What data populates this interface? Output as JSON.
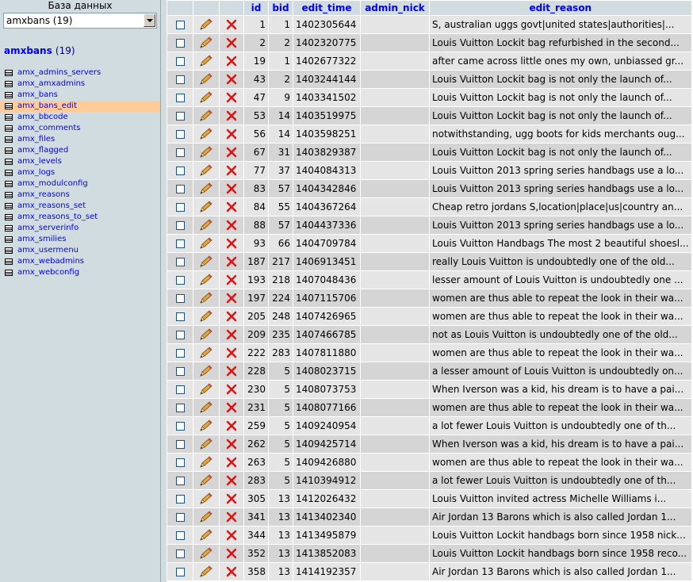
{
  "sidebar": {
    "db_label": "База данных",
    "db_select_value": "amxbans (19)",
    "db_name": "amxbans",
    "db_count": "(19)",
    "tables": [
      "amx_admins_servers",
      "amx_amxadmins",
      "amx_bans",
      "amx_bans_edit",
      "amx_bbcode",
      "amx_comments",
      "amx_files",
      "amx_flagged",
      "amx_levels",
      "amx_logs",
      "amx_modulconfig",
      "amx_reasons",
      "amx_reasons_set",
      "amx_reasons_to_set",
      "amx_serverinfo",
      "amx_smilies",
      "amx_usermenu",
      "amx_webadmins",
      "amx_webconfig"
    ],
    "active_table": "amx_bans_edit"
  },
  "table": {
    "columns": [
      "id",
      "bid",
      "edit_time",
      "admin_nick",
      "edit_reason"
    ],
    "rows": [
      [
        "1",
        "1",
        "1402305644",
        "",
        "S, australian uggs govt|united states|authorities|..."
      ],
      [
        "2",
        "2",
        "1402320775",
        "",
        "Louis Vuitton Lockit bag refurbished in the second..."
      ],
      [
        "19",
        "1",
        "1402677322",
        "",
        "after came across little ones my own, unbiassed gr..."
      ],
      [
        "43",
        "2",
        "1403244144",
        "",
        "Louis Vuitton Lockit bag is not only the launch of..."
      ],
      [
        "47",
        "9",
        "1403341502",
        "",
        "Louis Vuitton Lockit bag is not only the launch of..."
      ],
      [
        "53",
        "14",
        "1403519975",
        "",
        "Louis Vuitton Lockit bag is not only the launch of..."
      ],
      [
        "56",
        "14",
        "1403598251",
        "",
        "notwithstanding, ugg boots for kids  merchants oug..."
      ],
      [
        "67",
        "31",
        "1403829387",
        "",
        "Louis Vuitton Lockit bag is not only the launch of..."
      ],
      [
        "77",
        "37",
        "1404084313",
        "",
        "Louis Vuitton 2013 spring series handbags use a lo..."
      ],
      [
        "83",
        "57",
        "1404342846",
        "",
        "Louis Vuitton 2013 spring series handbags use a lo..."
      ],
      [
        "84",
        "55",
        "1404367264",
        "",
        "Cheap retro jordans S,location|place|us|country an..."
      ],
      [
        "88",
        "57",
        "1404437336",
        "",
        "Louis Vuitton 2013 spring series handbags use a lo..."
      ],
      [
        "93",
        "66",
        "1404709784",
        "",
        "Louis Vuitton Handbags The most 2 beautiful shoesl..."
      ],
      [
        "187",
        "217",
        "1406913451",
        "",
        "really Louis Vuitton is undoubtedly one of the old..."
      ],
      [
        "193",
        "218",
        "1407048436",
        "",
        "lesser amount of Louis Vuitton is undoubtedly one ..."
      ],
      [
        "197",
        "224",
        "1407115706",
        "",
        "women are thus able to repeat the look in their wa..."
      ],
      [
        "205",
        "248",
        "1407426965",
        "",
        "women are thus able to repeat the look in their wa..."
      ],
      [
        "209",
        "235",
        "1407466785",
        "",
        "not as Louis Vuitton is undoubtedly one of the old..."
      ],
      [
        "222",
        "283",
        "1407811880",
        "",
        "women are thus able to repeat the look in their wa..."
      ],
      [
        "228",
        "5",
        "1408023715",
        "",
        "a lesser amount of Louis Vuitton is undoubtedly on..."
      ],
      [
        "230",
        "5",
        "1408073753",
        "",
        "When Iverson was a kid, his dream is to have a pai..."
      ],
      [
        "231",
        "5",
        "1408077166",
        "",
        "women are thus able to repeat the look in their wa..."
      ],
      [
        "259",
        "5",
        "1409240954",
        "",
        "a lot fewer Louis Vuitton is undoubtedly one of th..."
      ],
      [
        "262",
        "5",
        "1409425714",
        "",
        "When Iverson was a kid, his dream is to have a pai..."
      ],
      [
        "263",
        "5",
        "1409426880",
        "",
        "women are thus able to repeat the look in their wa..."
      ],
      [
        "283",
        "5",
        "1410394912",
        "",
        "a lot fewer Louis Vuitton is undoubtedly one of th..."
      ],
      [
        "305",
        "13",
        "1412026432",
        "",
        "Louis Vuitton invited actress Michelle Williams i..."
      ],
      [
        "341",
        "13",
        "1413402340",
        "",
        "Air Jordan 13 Barons which is also called Jordan 1..."
      ],
      [
        "344",
        "13",
        "1413495879",
        "",
        "Louis Vuitton Lockit handbags born since 1958 nick..."
      ],
      [
        "352",
        "13",
        "1413852083",
        "",
        "Louis Vuitton Lockit handbags born since 1958 reco..."
      ],
      [
        "358",
        "13",
        "1414192357",
        "",
        "Air Jordan 13 Barons which is also called Jordan 1..."
      ]
    ]
  },
  "icons": {
    "edit": "pencil-icon",
    "delete": "delete-x-icon",
    "table": "table-icon"
  },
  "colors": {
    "header_bg": "#d0dce0",
    "link": "#0000ff",
    "active_bg": "#ffcc99",
    "row_odd": "#e5e5e5",
    "row_even": "#d5d5d5",
    "delete": "#ff0000"
  }
}
